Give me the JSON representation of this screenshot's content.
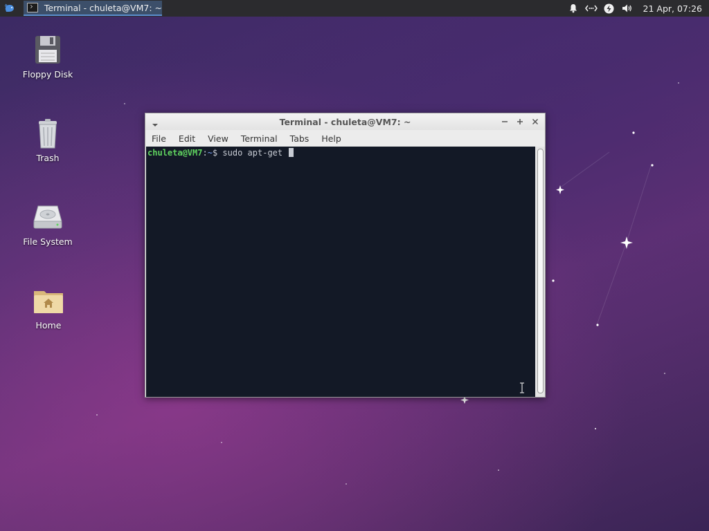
{
  "panel": {
    "taskbar_item_label": "Terminal - chuleta@VM7: ~",
    "clock": "21 Apr, 07:26",
    "tray_icons": [
      "notification-bell-icon",
      "network-icon",
      "power-icon",
      "volume-icon"
    ]
  },
  "desktop_icons": [
    {
      "label": "Floppy Disk",
      "icon": "floppy-disk-icon"
    },
    {
      "label": "Trash",
      "icon": "trash-icon"
    },
    {
      "label": "File System",
      "icon": "hard-drive-icon"
    },
    {
      "label": "Home",
      "icon": "home-folder-icon"
    }
  ],
  "terminal": {
    "title": "Terminal - chuleta@VM7: ~",
    "menu": [
      "File",
      "Edit",
      "View",
      "Terminal",
      "Tabs",
      "Help"
    ],
    "prompt_user": "chuleta@VM7",
    "prompt_sep": ":",
    "prompt_path": "~",
    "prompt_symbol": "$",
    "command": "sudo apt-get"
  },
  "colors": {
    "terminal_bg": "#131926",
    "prompt_user": "#5fd35f",
    "panel_bg": "#2b2b2e",
    "taskbar_active": "#3c4f6a"
  }
}
